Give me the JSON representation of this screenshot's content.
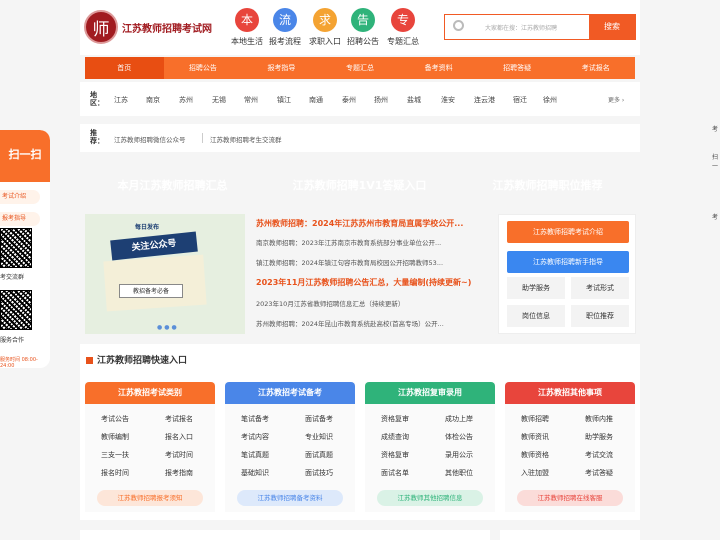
{
  "header": {
    "logo_char": "师",
    "site_name": "江苏教师招聘考试网",
    "nav": [
      {
        "label": "本地生活",
        "icon": "本",
        "color": "#e8453c"
      },
      {
        "label": "报考流程",
        "icon": "流",
        "color": "#4a86e8"
      },
      {
        "label": "求职入口",
        "icon": "求",
        "color": "#f4a332"
      },
      {
        "label": "招聘公告",
        "icon": "告",
        "color": "#2fb37a"
      },
      {
        "label": "专题汇总",
        "icon": "专",
        "color": "#e8453c"
      }
    ],
    "search_placeholder": "大家都在搜：江苏教师招聘",
    "search_button": "搜索"
  },
  "menu": [
    "首页",
    "招聘公告",
    "报考指导",
    "专题汇总",
    "备考资料",
    "招聘答疑",
    "考试报名"
  ],
  "area": {
    "title": "地区：",
    "cities": [
      "江苏",
      "南京",
      "苏州",
      "无锡",
      "常州",
      "镇江",
      "南通",
      "泰州",
      "扬州",
      "盐城",
      "淮安",
      "连云港",
      "宿迁",
      "徐州"
    ],
    "more": "更多"
  },
  "recommend": {
    "title": "推荐：",
    "links": [
      "江苏教师招聘微信公众号",
      "江苏教师招聘考生交流群"
    ]
  },
  "banners": [
    {
      "label": "本月江苏教师招聘汇总",
      "color": "#2f6fd6"
    },
    {
      "label": "江苏教师招聘1V1答疑入口",
      "color": "#8a96e6"
    },
    {
      "label": "江苏教师招聘职位推荐",
      "color": "#f86f2a"
    }
  ],
  "slide": {
    "tag": "每日发布",
    "board": "关注公众号",
    "note": "教招备考必备"
  },
  "news": [
    {
      "text": "苏州教师招聘：2024年江苏苏州市教育局直属学校公开...",
      "hl": true
    },
    {
      "text": "南京教师招聘：2023年江苏南京市教育系统部分事业单位公开...",
      "hl": false
    },
    {
      "text": "镇江教师招聘：2024年镇江句容市教育局校园公开招聘教师53...",
      "hl": false
    },
    {
      "text": "2023年11月江苏教师招聘公告汇总，大量编制(持续更新~)",
      "hl": true
    },
    {
      "text": "2023年10月江苏省教师招聘信息汇总（持续更新）",
      "hl": false
    },
    {
      "text": "苏州教师招聘：2024年昆山市教育系统赴高校(首高专场）公开...",
      "hl": false
    }
  ],
  "side_box": {
    "primary": "江苏教师招聘考试介绍",
    "secondary": "江苏教师招聘新手指导",
    "items": [
      "助学服务",
      "考试形式",
      "岗位信息",
      "职位推荐"
    ]
  },
  "quick": {
    "title": "江苏教师招聘快速入口",
    "cards": [
      {
        "title": "江苏教招考试类别",
        "color": "#f86f2a",
        "soft": "#fde6d9",
        "links": [
          "考试公告",
          "考试报名",
          "教师编制",
          "报名入口",
          "三支一扶",
          "考试时间",
          "报名时间",
          "报考指南"
        ],
        "footer": "江苏教师招聘报考须知"
      },
      {
        "title": "江苏教招考试备考",
        "color": "#4a86e8",
        "soft": "#dde9fb",
        "links": [
          "笔试备考",
          "面试备考",
          "考试内容",
          "专业知识",
          "笔试真题",
          "面试真题",
          "基础知识",
          "面试技巧"
        ],
        "footer": "江苏教师招聘备考资料"
      },
      {
        "title": "江苏教招复审录用",
        "color": "#2fb37a",
        "soft": "#daf2e6",
        "links": [
          "资格复审",
          "成功上岸",
          "成绩查询",
          "体检公告",
          "资格复审",
          "录用公示",
          "面试名单",
          "其他职位"
        ],
        "footer": "江苏教师其他招聘信息"
      },
      {
        "title": "江苏教招其他事项",
        "color": "#e8453c",
        "soft": "#fbdcd9",
        "links": [
          "教师招聘",
          "教师内推",
          "教师资讯",
          "助学服务",
          "教师资格",
          "考试交流",
          "入驻加盟",
          "考试答疑"
        ],
        "footer": "江苏教师招聘在线客服"
      }
    ]
  },
  "float": {
    "title": "扫一扫",
    "tags": [
      "考试介绍",
      "报考指导"
    ],
    "labels": [
      "考交流群",
      "服务合作"
    ],
    "time": "服务时间 08:00-24:00"
  },
  "edge_texts": [
    "考",
    "扫一",
    "考"
  ]
}
